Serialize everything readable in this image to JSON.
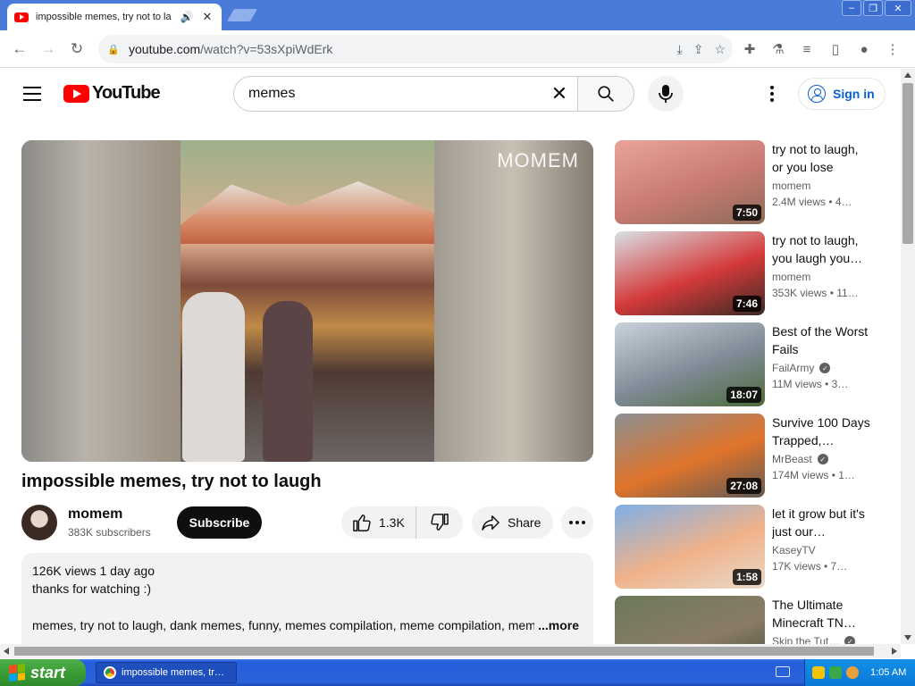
{
  "browser": {
    "tab_title": "impossible memes, try not to la",
    "url_host": "youtube.com",
    "url_path": "/watch?v=53sXpiWdErk"
  },
  "masthead": {
    "logo_text": "YouTube",
    "search_value": "memes",
    "signin_label": "Sign in"
  },
  "video": {
    "watermark": "MOMEM",
    "title": "impossible memes, try not to laugh",
    "channel": "momem",
    "subscribers": "383K subscribers",
    "subscribe_label": "Subscribe",
    "likes": "1.3K",
    "share_label": "Share"
  },
  "description": {
    "stats": "126K views  1 day ago",
    "line1": "thanks for watching :)",
    "tags": "memes, try not to laugh, dank memes, funny, memes compilation, meme compilation, memes",
    "more_label": "...more"
  },
  "recommendations": [
    {
      "title": "try not to laugh, or you lose",
      "channel": "momem",
      "verified": false,
      "meta": "2.4M views  • 4…",
      "duration": "7:50",
      "thumb": [
        "#e9a49a",
        "#c97a72",
        "#8a6b5a"
      ]
    },
    {
      "title": "try not to laugh, you laugh you…",
      "channel": "momem",
      "verified": false,
      "meta": "353K views  • 11…",
      "duration": "7:46",
      "thumb": [
        "#d9e0e6",
        "#d43a3a",
        "#3b2a25"
      ]
    },
    {
      "title": "Best of the Worst Fails",
      "channel": "FailArmy",
      "verified": true,
      "meta": "11M views  • 3…",
      "duration": "18:07",
      "thumb": [
        "#c9d3dc",
        "#7e8a95",
        "#4f6b3a"
      ]
    },
    {
      "title": "Survive 100 Days Trapped,…",
      "channel": "MrBeast",
      "verified": true,
      "meta": "174M views  • 1…",
      "duration": "27:08",
      "thumb": [
        "#8b8f92",
        "#e0742b",
        "#5f5a55"
      ]
    },
    {
      "title": "let it grow but it's just our…",
      "channel": "KaseyTV",
      "verified": false,
      "meta": "17K views  • 7…",
      "duration": "1:58",
      "thumb": [
        "#7fb0e6",
        "#f0b28a",
        "#e8d9c9"
      ]
    },
    {
      "title": "The Ultimate Minecraft TN…",
      "channel": "Skip the Tut…",
      "verified": true,
      "meta": "",
      "duration": "",
      "thumb": [
        "#6d7a5a",
        "#8a7b66",
        "#3d4a33"
      ]
    }
  ],
  "taskbar": {
    "start_label": "start",
    "task_label": "impossible memes, tr…",
    "clock": "1:05 AM"
  },
  "colors": {
    "yt_red": "#ff0000",
    "link_blue": "#065fd4",
    "xp_blue": "#245edb",
    "xp_green": "#3b9c36"
  }
}
